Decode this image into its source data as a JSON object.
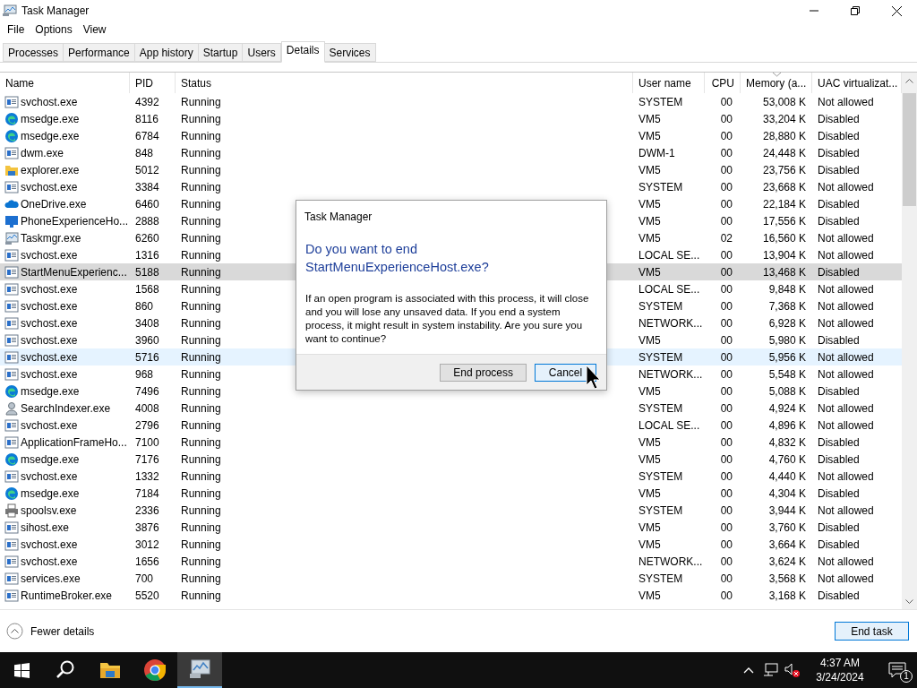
{
  "window": {
    "title": "Task Manager"
  },
  "menu": [
    "File",
    "Options",
    "View"
  ],
  "tabs": [
    {
      "label": "Processes",
      "selected": false
    },
    {
      "label": "Performance",
      "selected": false
    },
    {
      "label": "App history",
      "selected": false
    },
    {
      "label": "Startup",
      "selected": false
    },
    {
      "label": "Users",
      "selected": false
    },
    {
      "label": "Details",
      "selected": true
    },
    {
      "label": "Services",
      "selected": false
    }
  ],
  "table": {
    "columns": [
      {
        "label": "Name",
        "sorted": false
      },
      {
        "label": "PID",
        "sorted": false
      },
      {
        "label": "Status",
        "sorted": false
      },
      {
        "label": "User name",
        "sorted": false
      },
      {
        "label": "CPU",
        "sorted": false
      },
      {
        "label": "Memory (a...",
        "sorted": true
      },
      {
        "label": "UAC virtualizat...",
        "sorted": false
      }
    ],
    "rows": [
      {
        "kind": "service",
        "name": "svchost.exe",
        "pid": "4392",
        "status": "Running",
        "user": "SYSTEM",
        "cpu": "00",
        "memory": "53,008 K",
        "uac": "Not allowed",
        "selected": false,
        "hovered": false
      },
      {
        "kind": "edge",
        "name": "msedge.exe",
        "pid": "8116",
        "status": "Running",
        "user": "VM5",
        "cpu": "00",
        "memory": "33,204 K",
        "uac": "Disabled",
        "selected": false,
        "hovered": false
      },
      {
        "kind": "edge",
        "name": "msedge.exe",
        "pid": "6784",
        "status": "Running",
        "user": "VM5",
        "cpu": "00",
        "memory": "28,880 K",
        "uac": "Disabled",
        "selected": false,
        "hovered": false
      },
      {
        "kind": "service",
        "name": "dwm.exe",
        "pid": "848",
        "status": "Running",
        "user": "DWM-1",
        "cpu": "00",
        "memory": "24,448 K",
        "uac": "Disabled",
        "selected": false,
        "hovered": false
      },
      {
        "kind": "folder",
        "name": "explorer.exe",
        "pid": "5012",
        "status": "Running",
        "user": "VM5",
        "cpu": "00",
        "memory": "23,756 K",
        "uac": "Disabled",
        "selected": false,
        "hovered": false
      },
      {
        "kind": "service",
        "name": "svchost.exe",
        "pid": "3384",
        "status": "Running",
        "user": "SYSTEM",
        "cpu": "00",
        "memory": "23,668 K",
        "uac": "Not allowed",
        "selected": false,
        "hovered": false
      },
      {
        "kind": "cloud",
        "name": "OneDrive.exe",
        "pid": "6460",
        "status": "Running",
        "user": "VM5",
        "cpu": "00",
        "memory": "22,184 K",
        "uac": "Disabled",
        "selected": false,
        "hovered": false
      },
      {
        "kind": "monitor",
        "name": "PhoneExperienceHo...",
        "pid": "2888",
        "status": "Running",
        "user": "VM5",
        "cpu": "00",
        "memory": "17,556 K",
        "uac": "Disabled",
        "selected": false,
        "hovered": false
      },
      {
        "kind": "taskmgr",
        "name": "Taskmgr.exe",
        "pid": "6260",
        "status": "Running",
        "user": "VM5",
        "cpu": "02",
        "memory": "16,560 K",
        "uac": "Not allowed",
        "selected": false,
        "hovered": false
      },
      {
        "kind": "service",
        "name": "svchost.exe",
        "pid": "1316",
        "status": "Running",
        "user": "LOCAL SE...",
        "cpu": "00",
        "memory": "13,904 K",
        "uac": "Not allowed",
        "selected": false,
        "hovered": false
      },
      {
        "kind": "service",
        "name": "StartMenuExperienc...",
        "pid": "5188",
        "status": "Running",
        "user": "VM5",
        "cpu": "00",
        "memory": "13,468 K",
        "uac": "Disabled",
        "selected": true,
        "hovered": false
      },
      {
        "kind": "service",
        "name": "svchost.exe",
        "pid": "1568",
        "status": "Running",
        "user": "LOCAL SE...",
        "cpu": "00",
        "memory": "9,848 K",
        "uac": "Not allowed",
        "selected": false,
        "hovered": false
      },
      {
        "kind": "service",
        "name": "svchost.exe",
        "pid": "860",
        "status": "Running",
        "user": "SYSTEM",
        "cpu": "00",
        "memory": "7,368 K",
        "uac": "Not allowed",
        "selected": false,
        "hovered": false
      },
      {
        "kind": "service",
        "name": "svchost.exe",
        "pid": "3408",
        "status": "Running",
        "user": "NETWORK...",
        "cpu": "00",
        "memory": "6,928 K",
        "uac": "Not allowed",
        "selected": false,
        "hovered": false
      },
      {
        "kind": "service",
        "name": "svchost.exe",
        "pid": "3960",
        "status": "Running",
        "user": "VM5",
        "cpu": "00",
        "memory": "5,980 K",
        "uac": "Disabled",
        "selected": false,
        "hovered": false
      },
      {
        "kind": "service",
        "name": "svchost.exe",
        "pid": "5716",
        "status": "Running",
        "user": "SYSTEM",
        "cpu": "00",
        "memory": "5,956 K",
        "uac": "Not allowed",
        "selected": false,
        "hovered": true
      },
      {
        "kind": "service",
        "name": "svchost.exe",
        "pid": "968",
        "status": "Running",
        "user": "NETWORK...",
        "cpu": "00",
        "memory": "5,548 K",
        "uac": "Not allowed",
        "selected": false,
        "hovered": false
      },
      {
        "kind": "edge",
        "name": "msedge.exe",
        "pid": "7496",
        "status": "Running",
        "user": "VM5",
        "cpu": "00",
        "memory": "5,088 K",
        "uac": "Disabled",
        "selected": false,
        "hovered": false
      },
      {
        "kind": "person",
        "name": "SearchIndexer.exe",
        "pid": "4008",
        "status": "Running",
        "user": "SYSTEM",
        "cpu": "00",
        "memory": "4,924 K",
        "uac": "Not allowed",
        "selected": false,
        "hovered": false
      },
      {
        "kind": "service",
        "name": "svchost.exe",
        "pid": "2796",
        "status": "Running",
        "user": "LOCAL SE...",
        "cpu": "00",
        "memory": "4,896 K",
        "uac": "Not allowed",
        "selected": false,
        "hovered": false
      },
      {
        "kind": "service",
        "name": "ApplicationFrameHo...",
        "pid": "7100",
        "status": "Running",
        "user": "VM5",
        "cpu": "00",
        "memory": "4,832 K",
        "uac": "Disabled",
        "selected": false,
        "hovered": false
      },
      {
        "kind": "edge",
        "name": "msedge.exe",
        "pid": "7176",
        "status": "Running",
        "user": "VM5",
        "cpu": "00",
        "memory": "4,760 K",
        "uac": "Disabled",
        "selected": false,
        "hovered": false
      },
      {
        "kind": "service",
        "name": "svchost.exe",
        "pid": "1332",
        "status": "Running",
        "user": "SYSTEM",
        "cpu": "00",
        "memory": "4,440 K",
        "uac": "Not allowed",
        "selected": false,
        "hovered": false
      },
      {
        "kind": "edge",
        "name": "msedge.exe",
        "pid": "7184",
        "status": "Running",
        "user": "VM5",
        "cpu": "00",
        "memory": "4,304 K",
        "uac": "Disabled",
        "selected": false,
        "hovered": false
      },
      {
        "kind": "printer",
        "name": "spoolsv.exe",
        "pid": "2336",
        "status": "Running",
        "user": "SYSTEM",
        "cpu": "00",
        "memory": "3,944 K",
        "uac": "Not allowed",
        "selected": false,
        "hovered": false
      },
      {
        "kind": "service",
        "name": "sihost.exe",
        "pid": "3876",
        "status": "Running",
        "user": "VM5",
        "cpu": "00",
        "memory": "3,760 K",
        "uac": "Disabled",
        "selected": false,
        "hovered": false
      },
      {
        "kind": "service",
        "name": "svchost.exe",
        "pid": "3012",
        "status": "Running",
        "user": "VM5",
        "cpu": "00",
        "memory": "3,664 K",
        "uac": "Disabled",
        "selected": false,
        "hovered": false
      },
      {
        "kind": "service",
        "name": "svchost.exe",
        "pid": "1656",
        "status": "Running",
        "user": "NETWORK...",
        "cpu": "00",
        "memory": "3,624 K",
        "uac": "Not allowed",
        "selected": false,
        "hovered": false
      },
      {
        "kind": "service",
        "name": "services.exe",
        "pid": "700",
        "status": "Running",
        "user": "SYSTEM",
        "cpu": "00",
        "memory": "3,568 K",
        "uac": "Not allowed",
        "selected": false,
        "hovered": false
      },
      {
        "kind": "service",
        "name": "RuntimeBroker.exe",
        "pid": "5520",
        "status": "Running",
        "user": "VM5",
        "cpu": "00",
        "memory": "3,168 K",
        "uac": "Disabled",
        "selected": false,
        "hovered": false
      }
    ]
  },
  "dialog": {
    "title": "Task Manager",
    "heading": "Do you want to end StartMenuExperienceHost.exe?",
    "message": "If an open program is associated with this process, it will close and you will lose any unsaved data. If you end a system process, it might result in system instability. Are you sure you want to continue?",
    "buttons": [
      {
        "label": "End process",
        "focused": false
      },
      {
        "label": "Cancel",
        "focused": true
      }
    ]
  },
  "footer": {
    "toggle": "Fewer details",
    "action": "End task"
  },
  "taskbar": {
    "apps": [
      {
        "kind": "search",
        "active": false
      },
      {
        "kind": "folder",
        "active": false
      },
      {
        "kind": "chrome",
        "active": false
      },
      {
        "kind": "taskmgr",
        "active": true
      }
    ],
    "time": "4:37 AM",
    "date": "3/24/2024",
    "notifications": "1"
  }
}
